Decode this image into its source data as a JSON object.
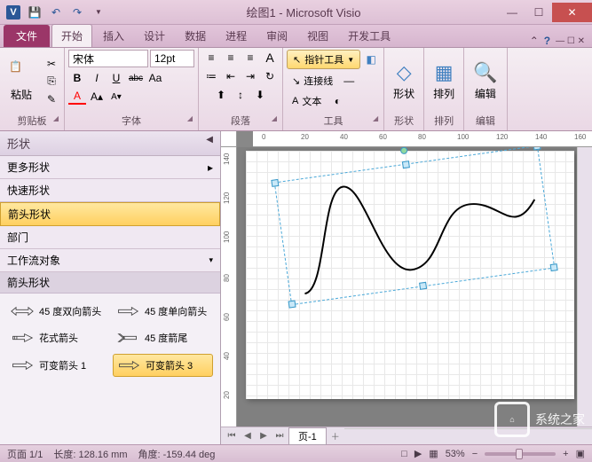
{
  "title": "绘图1 - Microsoft Visio",
  "qat_icons": [
    "visio",
    "save",
    "undo",
    "redo"
  ],
  "win": {
    "min": "—",
    "max": "☐",
    "close": "✕"
  },
  "tabs": {
    "file": "文件",
    "items": [
      "开始",
      "插入",
      "设计",
      "数据",
      "进程",
      "审阅",
      "视图",
      "开发工具"
    ],
    "active": 0,
    "help": "?"
  },
  "ribbon": {
    "clipboard": {
      "label": "剪贴板",
      "paste": "粘贴",
      "cut": "✂",
      "copy": "⎘",
      "brush": "✎"
    },
    "font": {
      "label": "字体",
      "family": "宋体",
      "size": "12pt",
      "bold": "B",
      "italic": "I",
      "underline": "U",
      "strike": "abc",
      "case": "Aa",
      "color": "A",
      "highlight": "A",
      "size_up": "A↑",
      "size_dn": "A↓"
    },
    "paragraph": {
      "label": "段落",
      "align_l": "≡",
      "align_c": "≡",
      "align_r": "≡",
      "size_txt": "A",
      "bullets": "≔",
      "indent_l": "⇤",
      "indent_r": "⇥",
      "rotate": "↻"
    },
    "tools": {
      "label": "工具",
      "pointer": "指针工具",
      "connector": "连接线",
      "text": "文本",
      "fill": "◧",
      "line": "—",
      "effect": "◐"
    },
    "shape_group": {
      "label": "形状",
      "btn": "形状"
    },
    "arrange": {
      "label": "排列",
      "btn": "排列"
    },
    "edit": {
      "label": "编辑",
      "btn": "编辑"
    }
  },
  "shapes_panel": {
    "header": "形状",
    "categories": [
      {
        "label": "更多形状",
        "arrow": "▸"
      },
      {
        "label": "快速形状"
      },
      {
        "label": "箭头形状",
        "selected": true
      },
      {
        "label": "部门"
      },
      {
        "label": "工作流对象"
      }
    ],
    "subheader": "箭头形状",
    "items": [
      {
        "label": "45 度双向箭头"
      },
      {
        "label": "45 度单向箭头"
      },
      {
        "label": "花式箭头"
      },
      {
        "label": "45 度箭尾"
      },
      {
        "label": "可变箭头 1"
      },
      {
        "label": "可变箭头 3",
        "selected": true
      }
    ]
  },
  "ruler": {
    "h": [
      "0",
      "20",
      "40",
      "60",
      "80",
      "100",
      "120",
      "140",
      "160"
    ],
    "v": [
      "140",
      "120",
      "100",
      "80",
      "60",
      "40",
      "20"
    ]
  },
  "page_tabs": {
    "current": "页-1",
    "nav": [
      "⏮",
      "◀",
      "▶",
      "⏭"
    ],
    "add": "＋"
  },
  "status": {
    "page": "页面 1/1",
    "length_label": "长度:",
    "length": "128.16 mm",
    "angle_label": "角度:",
    "angle": "-159.44 deg",
    "lang": "□",
    "zoom": "53%",
    "zoom_out": "−",
    "zoom_in": "+",
    "fit": "▣"
  },
  "watermark": "系统之家"
}
